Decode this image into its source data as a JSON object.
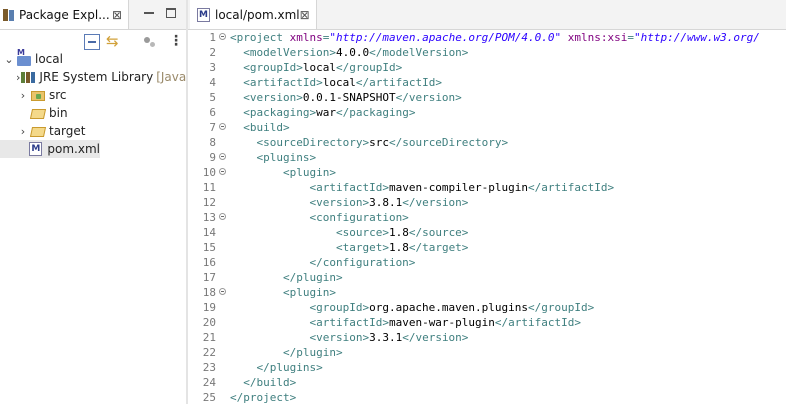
{
  "left_pane": {
    "tab_title": "Package Expl...",
    "close": "⊠",
    "tree": [
      {
        "label": "local",
        "icon": "maven-project-icon",
        "level": 0,
        "expanded": true
      },
      {
        "label": "JRE System Library",
        "decoration": "[JavaS",
        "icon": "library-icon",
        "level": 1,
        "expanded": false
      },
      {
        "label": "src",
        "icon": "folder-icon",
        "level": 1,
        "expanded": false
      },
      {
        "label": "bin",
        "icon": "folder-icon",
        "level": 1,
        "expanded": null
      },
      {
        "label": "target",
        "icon": "folder-icon",
        "level": 1,
        "expanded": false
      },
      {
        "label": "pom.xml",
        "icon": "maven-pom-file-icon",
        "level": 1,
        "selected": true
      }
    ]
  },
  "editor": {
    "tab_title": "local/pom.xml",
    "close": "⊠",
    "lines": [
      {
        "n": "1",
        "fold": true,
        "tokens": [
          [
            "tag",
            "<project "
          ],
          [
            "attr",
            "xmlns"
          ],
          [
            "tag",
            "="
          ],
          [
            "str",
            "\"http://maven.apache.org/POM/4.0.0\""
          ],
          [
            "tag",
            " "
          ],
          [
            "attr",
            "xmlns:xsi"
          ],
          [
            "tag",
            "="
          ],
          [
            "str",
            "\"http://www.w3.org/"
          ]
        ]
      },
      {
        "n": "2",
        "fold": false,
        "tokens": [
          [
            "tag",
            "  <modelVersion>"
          ],
          [
            "txt",
            "4.0.0"
          ],
          [
            "tag",
            "</modelVersion>"
          ]
        ]
      },
      {
        "n": "3",
        "fold": false,
        "tokens": [
          [
            "tag",
            "  <groupId>"
          ],
          [
            "txt",
            "local"
          ],
          [
            "tag",
            "</groupId>"
          ]
        ]
      },
      {
        "n": "4",
        "fold": false,
        "tokens": [
          [
            "tag",
            "  <artifactId>"
          ],
          [
            "txt",
            "local"
          ],
          [
            "tag",
            "</artifactId>"
          ]
        ]
      },
      {
        "n": "5",
        "fold": false,
        "tokens": [
          [
            "tag",
            "  <version>"
          ],
          [
            "txt",
            "0.0.1-SNAPSHOT"
          ],
          [
            "tag",
            "</version>"
          ]
        ]
      },
      {
        "n": "6",
        "fold": false,
        "tokens": [
          [
            "tag",
            "  <packaging>"
          ],
          [
            "txt",
            "war"
          ],
          [
            "tag",
            "</packaging>"
          ]
        ]
      },
      {
        "n": "7",
        "fold": true,
        "tokens": [
          [
            "tag",
            "  <build>"
          ]
        ]
      },
      {
        "n": "8",
        "fold": false,
        "tokens": [
          [
            "tag",
            "    <sourceDirectory>"
          ],
          [
            "txt",
            "src"
          ],
          [
            "tag",
            "</sourceDirectory>"
          ]
        ]
      },
      {
        "n": "9",
        "fold": true,
        "tokens": [
          [
            "tag",
            "    <plugins>"
          ]
        ]
      },
      {
        "n": "10",
        "fold": true,
        "tokens": [
          [
            "tag",
            "        <plugin>"
          ]
        ]
      },
      {
        "n": "11",
        "fold": false,
        "tokens": [
          [
            "tag",
            "            <artifactId>"
          ],
          [
            "txt",
            "maven-compiler-plugin"
          ],
          [
            "tag",
            "</artifactId>"
          ]
        ]
      },
      {
        "n": "12",
        "fold": false,
        "tokens": [
          [
            "tag",
            "            <version>"
          ],
          [
            "txt",
            "3.8.1"
          ],
          [
            "tag",
            "</version>"
          ]
        ]
      },
      {
        "n": "13",
        "fold": true,
        "tokens": [
          [
            "tag",
            "            <configuration>"
          ]
        ]
      },
      {
        "n": "14",
        "fold": false,
        "tokens": [
          [
            "tag",
            "                <source>"
          ],
          [
            "txt",
            "1.8"
          ],
          [
            "tag",
            "</source>"
          ]
        ]
      },
      {
        "n": "15",
        "fold": false,
        "tokens": [
          [
            "tag",
            "                <target>"
          ],
          [
            "txt",
            "1.8"
          ],
          [
            "tag",
            "</target>"
          ]
        ]
      },
      {
        "n": "16",
        "fold": false,
        "tokens": [
          [
            "tag",
            "            </configuration>"
          ]
        ]
      },
      {
        "n": "17",
        "fold": false,
        "tokens": [
          [
            "tag",
            "        </plugin>"
          ]
        ]
      },
      {
        "n": "18",
        "fold": true,
        "tokens": [
          [
            "tag",
            "        <plugin>"
          ]
        ]
      },
      {
        "n": "19",
        "fold": false,
        "tokens": [
          [
            "tag",
            "            <groupId>"
          ],
          [
            "txt",
            "org.apache.maven.plugins"
          ],
          [
            "tag",
            "</groupId>"
          ]
        ]
      },
      {
        "n": "20",
        "fold": false,
        "tokens": [
          [
            "tag",
            "            <artifactId>"
          ],
          [
            "txt",
            "maven-war-plugin"
          ],
          [
            "tag",
            "</artifactId>"
          ]
        ]
      },
      {
        "n": "21",
        "fold": false,
        "tokens": [
          [
            "tag",
            "            <version>"
          ],
          [
            "txt",
            "3.3.1"
          ],
          [
            "tag",
            "</version>"
          ]
        ]
      },
      {
        "n": "22",
        "fold": false,
        "tokens": [
          [
            "tag",
            "        </plugin>"
          ]
        ]
      },
      {
        "n": "23",
        "fold": false,
        "tokens": [
          [
            "tag",
            "    </plugins>"
          ]
        ]
      },
      {
        "n": "24",
        "fold": false,
        "tokens": [
          [
            "tag",
            "  </build>"
          ]
        ]
      },
      {
        "n": "25",
        "fold": false,
        "tokens": [
          [
            "tag",
            "</project>"
          ]
        ]
      }
    ]
  },
  "colors": {
    "tag": "#3f7f7f",
    "attr": "#7f007f",
    "string": "#2a00ff",
    "text": "#000000",
    "line_number": "#787878",
    "selection": "#e8e8e8"
  }
}
